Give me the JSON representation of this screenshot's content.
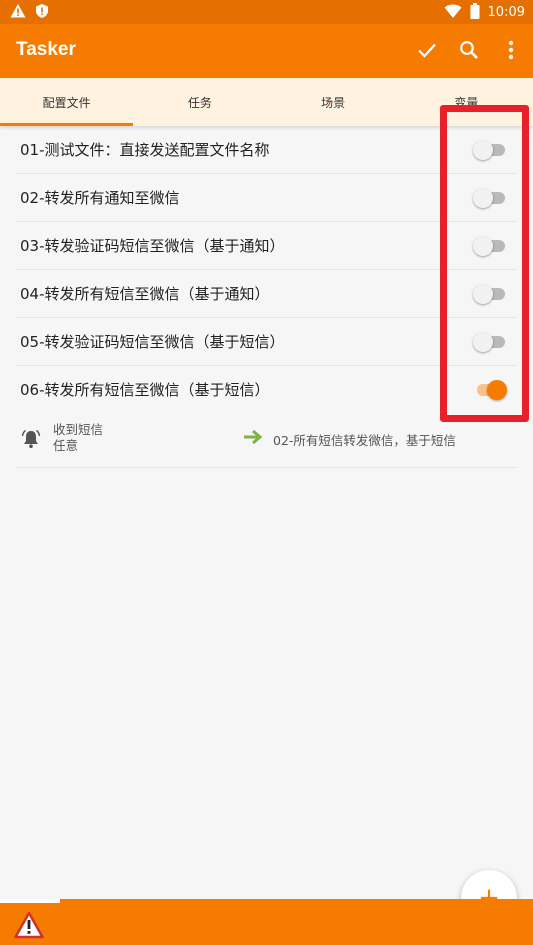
{
  "status_bar": {
    "time": "10:09",
    "icons": [
      "warning-icon",
      "shield-icon",
      "wifi-icon",
      "battery-icon"
    ]
  },
  "app_bar": {
    "title": "Tasker",
    "actions": [
      "check-icon",
      "search-icon",
      "more-vert-icon"
    ]
  },
  "tabs": [
    {
      "label": "配置文件",
      "active": true
    },
    {
      "label": "任务",
      "active": false
    },
    {
      "label": "场景",
      "active": false
    },
    {
      "label": "变量",
      "active": false
    }
  ],
  "profiles": [
    {
      "label": "01-测试文件：直接发送配置文件名称",
      "enabled": false
    },
    {
      "label": "02-转发所有通知至微信",
      "enabled": false
    },
    {
      "label": "03-转发验证码短信至微信（基于通知）",
      "enabled": false
    },
    {
      "label": "04-转发所有短信至微信（基于通知）",
      "enabled": false
    },
    {
      "label": "05-转发验证码短信至微信（基于短信）",
      "enabled": false
    },
    {
      "label": "06-转发所有短信至微信（基于短信）",
      "enabled": true
    }
  ],
  "profile_detail": {
    "context_title": "收到短信",
    "context_sub": "任意",
    "task": "02-所有短信转发微信，基于短信"
  },
  "colors": {
    "primary": "#f57c00",
    "status_bar": "#e56f00",
    "tab_bg": "#fff3e0",
    "highlight": "#e8202a"
  },
  "fab": {
    "icon": "plus-icon",
    "label": "+"
  }
}
